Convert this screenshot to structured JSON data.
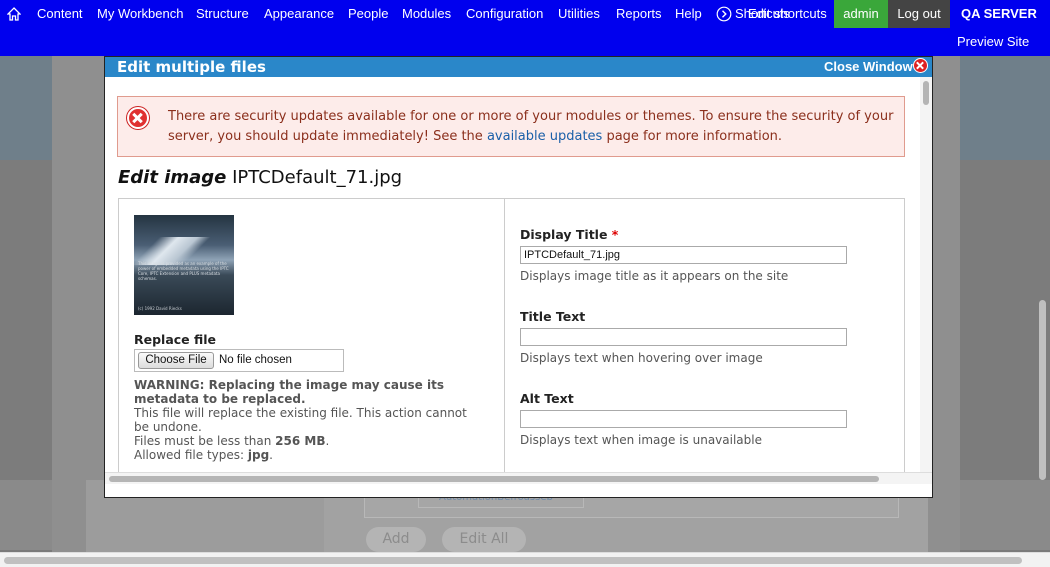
{
  "toolbar": {
    "menu": [
      "Content",
      "My Workbench",
      "Structure",
      "Appearance",
      "People",
      "Modules",
      "Configuration",
      "Utilities",
      "Reports",
      "Help"
    ],
    "shortcuts_label": "Shortcuts",
    "edit_shortcuts_label": "Edit shortcuts",
    "admin_label": "admin",
    "logout_label": "Log out",
    "server_label": "QA SERVER",
    "preview_label": "Preview Site"
  },
  "modal": {
    "title": "Edit multiple files",
    "close_label": "Close Window"
  },
  "alert": {
    "text_before": "There are security updates available for one or more of your modules or themes. To ensure the security of your server, you should update immediately! See the ",
    "link": "available updates",
    "text_after": " page for more information."
  },
  "heading": {
    "prefix": "Edit image",
    "filename": "IPTCDefault_71.jpg"
  },
  "thumbnail": {
    "caption": "This image is provided as an example of the power of embedded metadata using the IPTC Core, IPTC Extension and PLUS metadata schemas.",
    "copyright": "(c) 1992 David Riecks"
  },
  "replace": {
    "label": "Replace file",
    "button": "Choose File",
    "no_file": "No file chosen",
    "warning": "WARNING: Replacing the image may cause its metadata to be replaced.",
    "help1": "This file will replace the existing file. This action cannot be undone.",
    "size_prefix": "Files must be less than ",
    "size_value": "256 MB",
    "size_suffix": ".",
    "types_prefix": "Allowed file types: ",
    "types_value": "jpg",
    "types_suffix": "."
  },
  "fields": {
    "display_title": {
      "label": "Display Title",
      "required": "*",
      "value": "IPTCDefault_71.jpg",
      "help": "Displays image title as it appears on the site"
    },
    "title_text": {
      "label": "Title Text",
      "value": "",
      "help": "Displays text when hovering over image"
    },
    "alt_text": {
      "label": "Alt Text",
      "value": "",
      "help": "Displays text when image is unavailable"
    }
  },
  "background": {
    "link_text": "AutomationBefroasseb",
    "add_label": "Add",
    "edit_all_label": "Edit All"
  }
}
